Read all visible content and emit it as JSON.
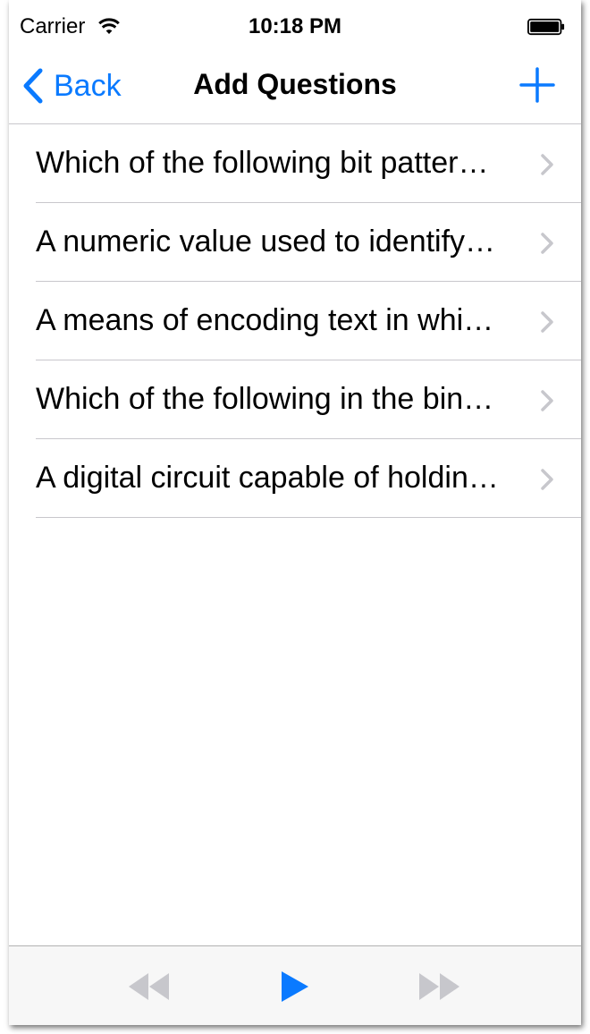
{
  "status_bar": {
    "carrier": "Carrier",
    "time": "10:18 PM"
  },
  "nav": {
    "back_label": "Back",
    "title": "Add Questions",
    "add_icon": "plus-icon"
  },
  "questions": [
    "Which of the following bit patter…",
    "A numeric value used to identify…",
    "A means of encoding text in whi…",
    "Which of the following in the bin…",
    "A digital circuit capable of holdin…"
  ],
  "toolbar": {
    "rewind_icon": "rewind-icon",
    "play_icon": "play-icon",
    "fast_forward_icon": "fast-forward-icon"
  },
  "colors": {
    "accent": "#0a7aff",
    "disabled": "#c7c7cc",
    "separator": "#c8c7cc",
    "chevron": "#c7c7cc"
  }
}
